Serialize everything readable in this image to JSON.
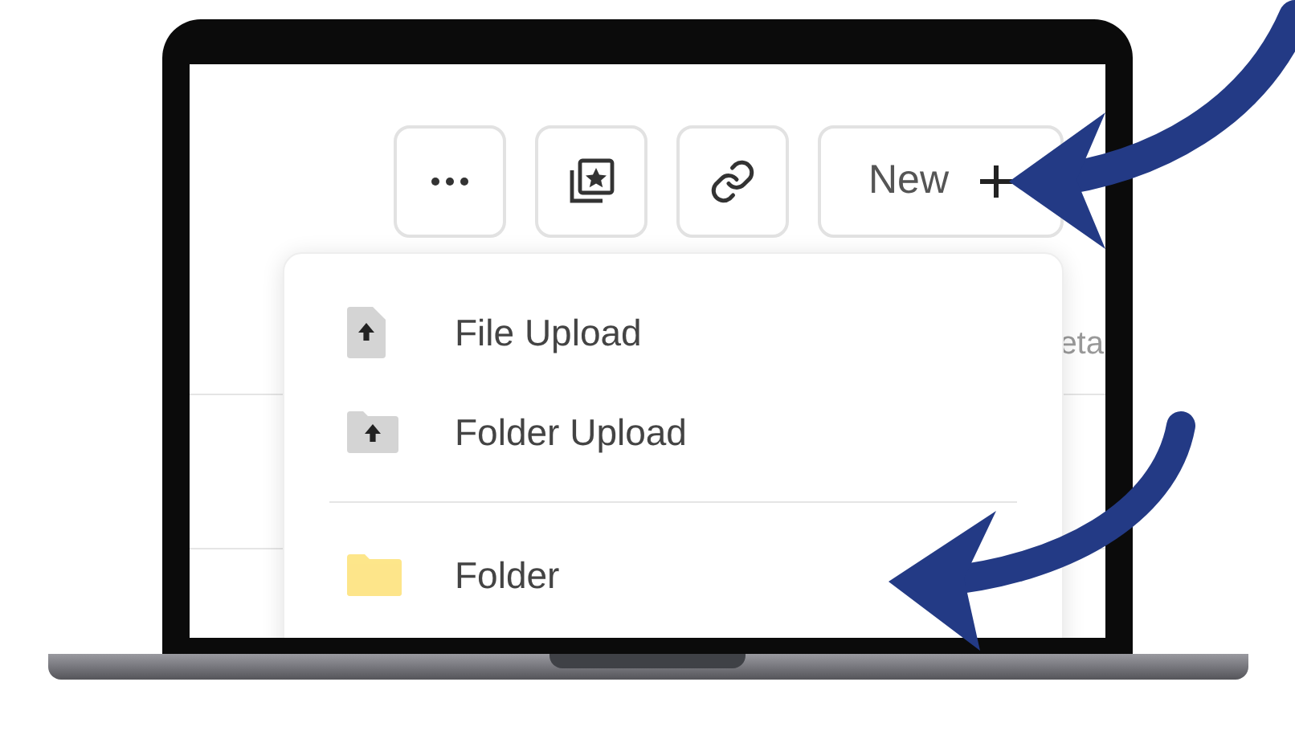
{
  "toolbar": {
    "buttons": [
      {
        "kind": "more"
      },
      {
        "kind": "collection"
      },
      {
        "kind": "link"
      },
      {
        "kind": "new",
        "label": "New"
      }
    ]
  },
  "table": {
    "header_partial": "eta"
  },
  "menu": {
    "sections": [
      [
        {
          "kind": "file_upload",
          "label": "File Upload"
        },
        {
          "kind": "folder_upload",
          "label": "Folder Upload"
        }
      ],
      [
        {
          "kind": "folder",
          "label": "Folder"
        }
      ]
    ]
  }
}
